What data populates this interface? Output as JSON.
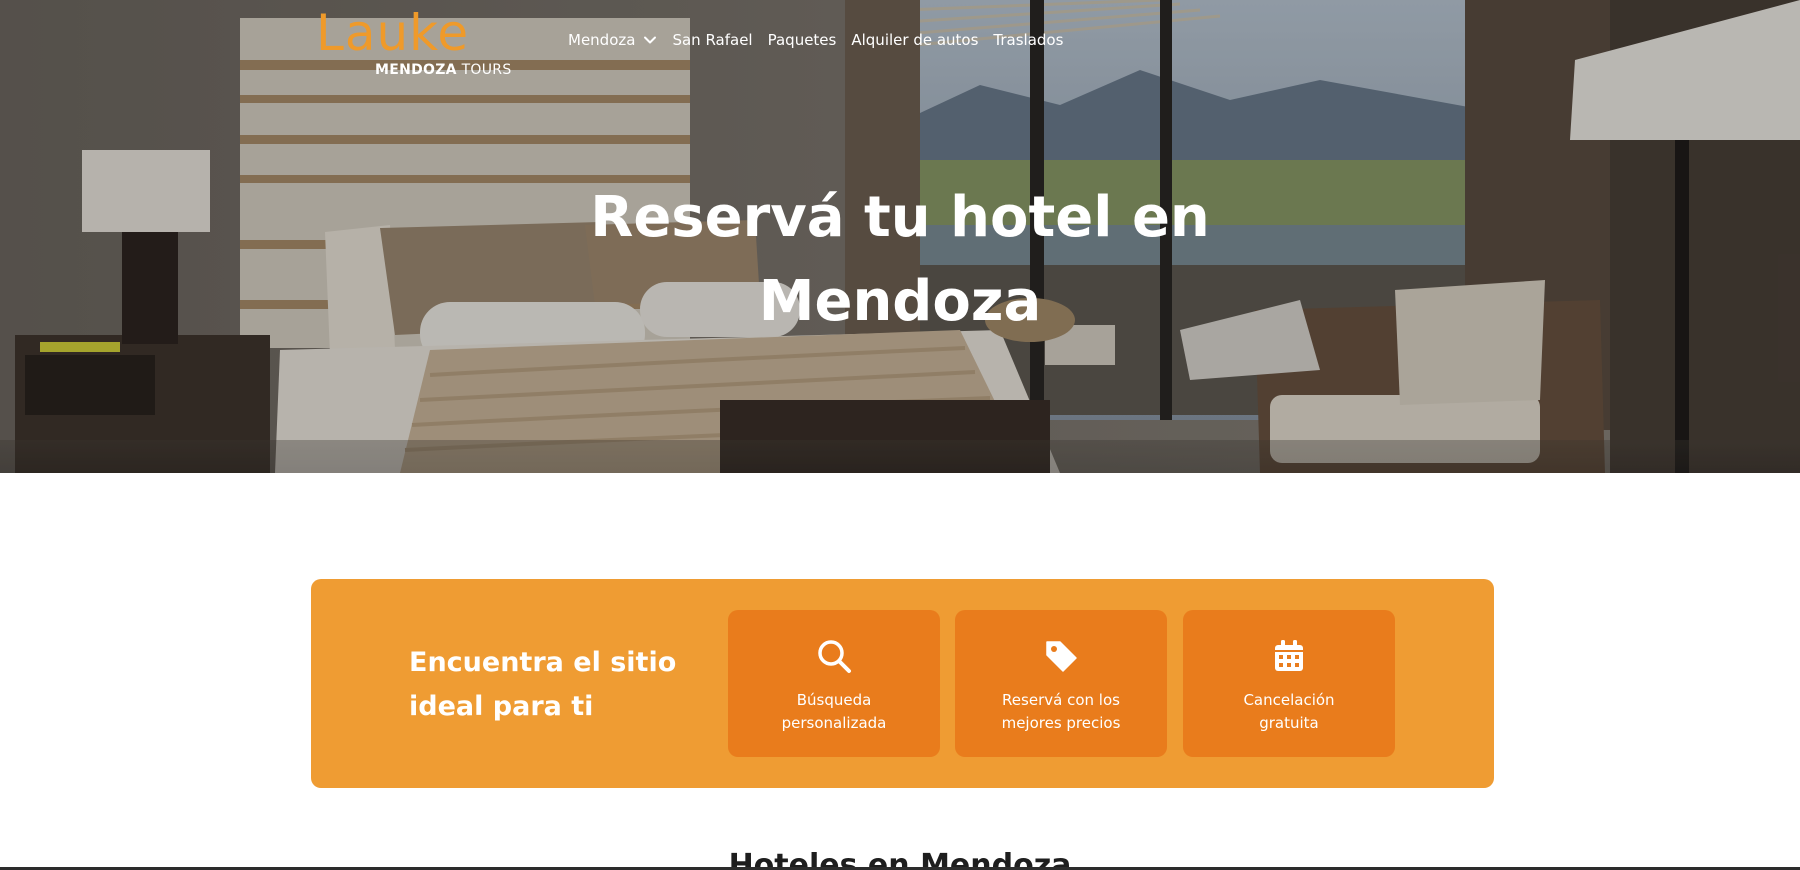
{
  "brand": {
    "wordmark": "Lauke",
    "sub_bold": "MENDOZA",
    "sub_light": " TOURS",
    "accent_color": "#ef9c33",
    "card_color": "#e97c1c"
  },
  "nav": {
    "items": [
      {
        "label": "Mendoza",
        "has_dropdown": true
      },
      {
        "label": "San Rafael"
      },
      {
        "label": "Paquetes"
      },
      {
        "label": "Alquiler de autos"
      },
      {
        "label": "Traslados"
      }
    ]
  },
  "hero": {
    "title_line1": "Reservá tu hotel en",
    "title_line2": "Mendoza",
    "background_description_icon": "hotel-room-photo"
  },
  "features": {
    "lead_line1": "Encuentra el sitio",
    "lead_line2": "ideal para ti",
    "cards": [
      {
        "icon": "search-icon",
        "line1": "Búsqueda",
        "line2": "personalizada"
      },
      {
        "icon": "tag-icon",
        "line1": "Reservá con los",
        "line2": "mejores precios"
      },
      {
        "icon": "calendar-icon",
        "line1": "Cancelación",
        "line2": "gratuita"
      }
    ]
  },
  "section": {
    "title": "Hoteles en Mendoza"
  }
}
